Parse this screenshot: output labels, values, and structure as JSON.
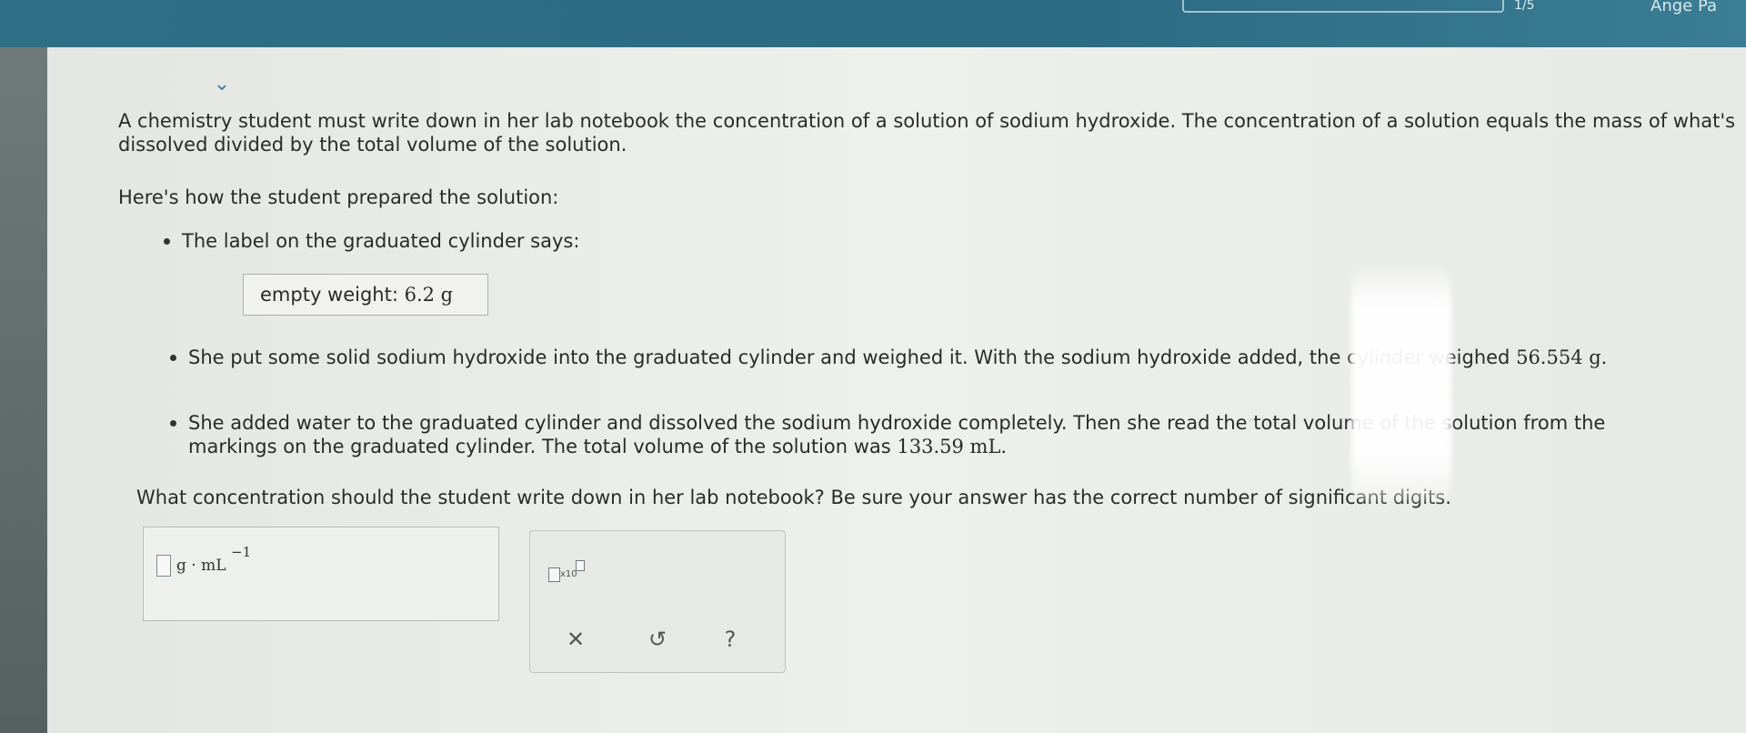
{
  "header": {
    "progress_counter": "1/5",
    "user_name": "Ange Pa"
  },
  "problem": {
    "intro": "A chemistry student must write down in her lab notebook the concentration of a solution of sodium hydroxide. The concentration of a solution equals the mass of what's dissolved divided by the total volume of the solution.",
    "howto": "Here's how the student prepared the solution:",
    "bullet1": "The label on the graduated cylinder says:",
    "label_text": "empty weight:",
    "label_value": "6.2 g",
    "bullet2_text": "She put some solid sodium hydroxide into the graduated cylinder and weighed it. With the sodium hydroxide added, the cylinder weighed",
    "bullet2_value": "56.554 g.",
    "bullet3_text": "She added water to the graduated cylinder and dissolved the sodium hydroxide completely. Then she read the total volume of the solution from the markings on the graduated cylinder. The total volume of the solution was",
    "bullet3_value": "133.59 mL.",
    "question": "What concentration should the student write down in her lab notebook? Be sure your answer has the correct number of significant digits."
  },
  "answer": {
    "unit": "g · mL",
    "unit_exponent": "−1"
  },
  "tools": {
    "sci_notation_label": "x10",
    "clear_symbol": "✕",
    "undo_symbol": "↺",
    "help_symbol": "?"
  }
}
